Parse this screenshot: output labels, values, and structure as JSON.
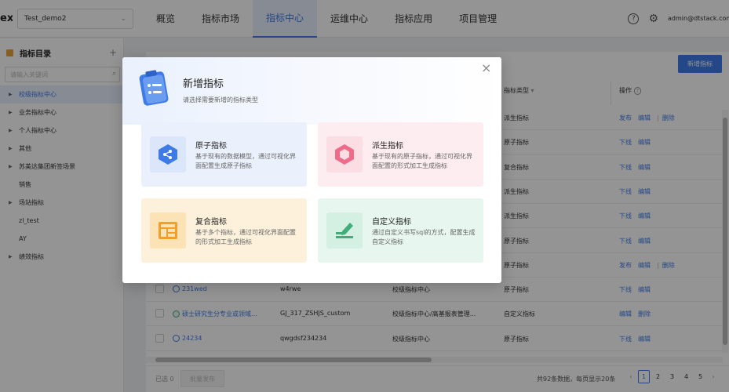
{
  "header": {
    "logo": "ex",
    "project": "Test_demo2",
    "nav": [
      "概览",
      "指标市场",
      "指标中心",
      "运维中心",
      "指标应用",
      "项目管理"
    ],
    "active_nav": 2,
    "help": "?",
    "user": "admin@dtstack.com"
  },
  "sidebar": {
    "title": "指标目录",
    "add": "+",
    "search_placeholder": "请输入关键词",
    "items": [
      {
        "label": "校级指标中心",
        "arrow": true,
        "active": true
      },
      {
        "label": "业务指标中心",
        "arrow": true
      },
      {
        "label": "个人指标中心",
        "arrow": true
      },
      {
        "label": "其他",
        "arrow": true
      },
      {
        "label": "苏美达集团新签场景",
        "arrow": true
      },
      {
        "label": "销售",
        "arrow": false
      },
      {
        "label": "场站指标",
        "arrow": true
      },
      {
        "label": "zl_test",
        "arrow": false
      },
      {
        "label": "AY",
        "arrow": false
      },
      {
        "label": "绩效指标",
        "arrow": true
      }
    ]
  },
  "main": {
    "new_button": "新增指标",
    "col_type": "指标类型",
    "col_ops": "操作",
    "rows": [
      {
        "name": "",
        "code": "",
        "dir": "",
        "type": "派生指标",
        "ops": [
          "发布",
          "编辑",
          "删除"
        ]
      },
      {
        "name": "",
        "code": "",
        "dir": "",
        "type": "原子指标",
        "ops": [
          "下线",
          "编辑"
        ]
      },
      {
        "name": "",
        "code": "",
        "dir": "",
        "type": "复合指标",
        "ops": [
          "下线",
          "编辑"
        ]
      },
      {
        "name": "",
        "code": "",
        "dir": "",
        "type": "派生指标",
        "ops": [
          "下线",
          "编辑"
        ]
      },
      {
        "name": "",
        "code": "",
        "dir": "",
        "type": "派生指标",
        "ops": [
          "下线",
          "编辑"
        ]
      },
      {
        "name": "",
        "code": "",
        "dir": "",
        "type": "原子指标",
        "ops": [
          "下线",
          "编辑"
        ]
      },
      {
        "name": "",
        "code": "",
        "dir": "",
        "type": "原子指标",
        "ops": [
          "发布",
          "编辑",
          "删除"
        ]
      },
      {
        "name": "231wed",
        "code": "w4rwe",
        "dir": "校级指标中心",
        "type": "原子指标",
        "ops": [
          "下线",
          "编辑"
        ]
      },
      {
        "name": "硕士研究生分专业或领域...",
        "code": "GJ_317_ZSHJS_custom",
        "dir": "校级指标中心/高基报表管理...",
        "type": "自定义指标",
        "ops": [
          "编辑",
          "删除"
        ]
      },
      {
        "name": "24234",
        "code": "qwgdsf234234",
        "dir": "校级指标中心",
        "type": "原子指标",
        "ops": [
          "下线",
          "编辑"
        ]
      }
    ],
    "footer": {
      "selected": "已选 0",
      "batch": "批量发布",
      "total": "共92条数据，每页显示20条",
      "pages": [
        "1",
        "2",
        "3",
        "4",
        "5"
      ],
      "current_page": "1"
    }
  },
  "modal": {
    "title": "新增指标",
    "subtitle": "请选择需要新增的指标类型",
    "close": "×",
    "cards": [
      {
        "title": "原子指标",
        "desc": "基于现有的数据模型，通过可视化界面配置生成原子指标",
        "icon": "atom-hexagon-icon"
      },
      {
        "title": "派生指标",
        "desc": "基于现有的原子指标，通过可视化界面配置的形式加工生成指标",
        "icon": "derived-hexagon-icon"
      },
      {
        "title": "复合指标",
        "desc": "基于多个指标，通过可视化界面配置的形式加工生成指标",
        "icon": "composite-layout-icon"
      },
      {
        "title": "自定义指标",
        "desc": "通过自定义书写sql的方式，配置生成自定义指标",
        "icon": "pen-edit-icon"
      }
    ]
  }
}
